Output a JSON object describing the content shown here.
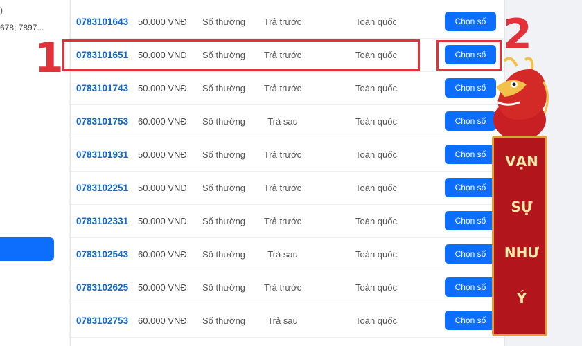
{
  "left_panel": {
    "text_line_1": ")",
    "text_line_2": "678; 7897..."
  },
  "table": {
    "rows": [
      {
        "number": "0783101643",
        "price": "50.000 VNĐ",
        "type": "Số thường",
        "payment": "Trả trước",
        "area": "Toàn quốc",
        "button": "Chọn số"
      },
      {
        "number": "0783101651",
        "price": "50.000 VNĐ",
        "type": "Số thường",
        "payment": "Trả trước",
        "area": "Toàn quốc",
        "button": "Chọn số"
      },
      {
        "number": "0783101743",
        "price": "50.000 VNĐ",
        "type": "Số thường",
        "payment": "Trả trước",
        "area": "Toàn quốc",
        "button": "Chọn số"
      },
      {
        "number": "0783101753",
        "price": "60.000 VNĐ",
        "type": "Số thường",
        "payment": "Trả sau",
        "area": "Toàn quốc",
        "button": "Chọn số"
      },
      {
        "number": "0783101931",
        "price": "50.000 VNĐ",
        "type": "Số thường",
        "payment": "Trả trước",
        "area": "Toàn quốc",
        "button": "Chọn số"
      },
      {
        "number": "0783102251",
        "price": "50.000 VNĐ",
        "type": "Số thường",
        "payment": "Trả trước",
        "area": "Toàn quốc",
        "button": "Chọn số"
      },
      {
        "number": "0783102331",
        "price": "50.000 VNĐ",
        "type": "Số thường",
        "payment": "Trả trước",
        "area": "Toàn quốc",
        "button": "Chọn số"
      },
      {
        "number": "0783102543",
        "price": "60.000 VNĐ",
        "type": "Số thường",
        "payment": "Trả sau",
        "area": "Toàn quốc",
        "button": "Chọn số"
      },
      {
        "number": "0783102625",
        "price": "50.000 VNĐ",
        "type": "Số thường",
        "payment": "Trả trước",
        "area": "Toàn quốc",
        "button": "Chọn số"
      },
      {
        "number": "0783102753",
        "price": "60.000 VNĐ",
        "type": "Số thường",
        "payment": "Trả sau",
        "area": "Toàn quốc",
        "button": "Chọn số"
      }
    ]
  },
  "annotations": {
    "step_1": "1",
    "step_2": "2",
    "highlight_color": "#e3313a"
  },
  "banner": {
    "words": [
      "VẠN",
      "SỰ",
      "NHƯ",
      "Ý"
    ],
    "icon": "dragon-icon"
  },
  "colors": {
    "accent": "#0d6efd",
    "number_link": "#0b67d4"
  }
}
